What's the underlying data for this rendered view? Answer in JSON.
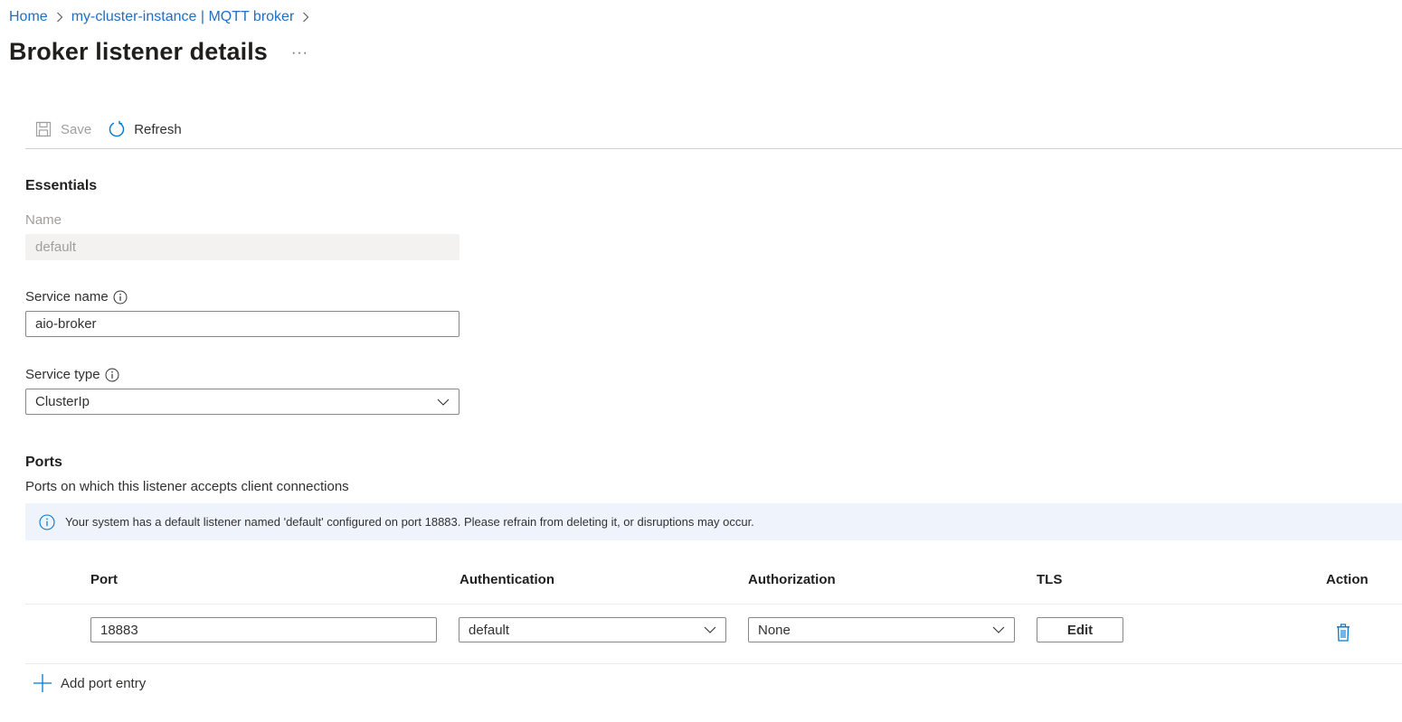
{
  "breadcrumb": {
    "items": [
      {
        "label": "Home"
      },
      {
        "label": "my-cluster-instance | MQTT broker"
      }
    ]
  },
  "header": {
    "title": "Broker listener details",
    "more_label": "···"
  },
  "toolbar": {
    "save_label": "Save",
    "refresh_label": "Refresh"
  },
  "essentials": {
    "title": "Essentials",
    "name": {
      "label": "Name",
      "value": "default"
    },
    "service_name": {
      "label": "Service name",
      "value": "aio-broker"
    },
    "service_type": {
      "label": "Service type",
      "value": "ClusterIp"
    }
  },
  "ports": {
    "title": "Ports",
    "description": "Ports on which this listener accepts client connections",
    "info_message": "Your system has a default listener named 'default' configured on port 18883. Please refrain from deleting it, or disruptions may occur.",
    "columns": [
      "Port",
      "Authentication",
      "Authorization",
      "TLS",
      "Action"
    ],
    "rows": [
      {
        "port": "18883",
        "authentication": "default",
        "authorization": "None",
        "tls_button": "Edit"
      }
    ],
    "add_label": "Add port entry"
  },
  "colors": {
    "link": "#1f6fc5",
    "accent": "#0078d4",
    "info_bg": "#eff4fc",
    "disabled_bg": "#f3f2f1"
  }
}
